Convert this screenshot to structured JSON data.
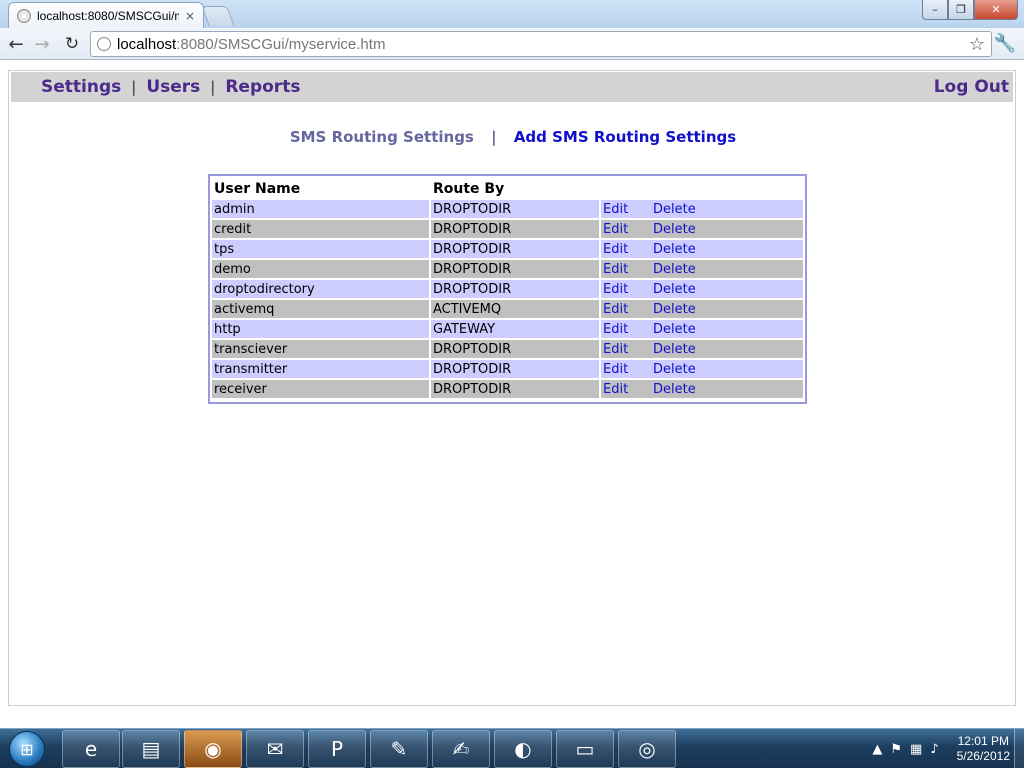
{
  "browser": {
    "tab_title": "localhost:8080/SMSCGui/m",
    "tab_close": "×",
    "url_host": "localhost",
    "url_rest": ":8080/SMSCGui/myservice.htm",
    "back_glyph": "←",
    "forward_glyph": "→",
    "reload_glyph": "↻",
    "star_glyph": "☆",
    "wrench_glyph": "🔧",
    "min_glyph": "–",
    "max_glyph": "❐",
    "close_glyph": "✕"
  },
  "topnav": {
    "settings": "Settings",
    "users": "Users",
    "reports": "Reports",
    "separator": "|",
    "logout": "Log Out"
  },
  "subnav": {
    "current": "SMS Routing Settings",
    "separator": "|",
    "add": "Add SMS Routing Settings"
  },
  "table": {
    "headers": {
      "user_name": "User Name",
      "route_by": "Route By"
    },
    "edit_label": "Edit",
    "delete_label": "Delete",
    "rows": [
      {
        "user": "admin",
        "route": "DROPTODIR"
      },
      {
        "user": "credit",
        "route": "DROPTODIR"
      },
      {
        "user": "tps",
        "route": "DROPTODIR"
      },
      {
        "user": "demo",
        "route": "DROPTODIR"
      },
      {
        "user": "droptodirectory",
        "route": "DROPTODIR"
      },
      {
        "user": "activemq",
        "route": "ACTIVEMQ"
      },
      {
        "user": "http",
        "route": "GATEWAY"
      },
      {
        "user": "transciever",
        "route": "DROPTODIR"
      },
      {
        "user": "transmitter",
        "route": "DROPTODIR"
      },
      {
        "user": "receiver",
        "route": "DROPTODIR"
      }
    ]
  },
  "colors": {
    "nav_purple": "#4a2a8a",
    "link_blue": "#1010cc",
    "row_odd": "#ccccff",
    "row_even": "#c0c0c0",
    "nav_bar": "#d3d3d3"
  },
  "taskbar": {
    "apps": [
      "internet-explorer-icon",
      "explorer-icon",
      "firefox-icon",
      "gtalk-icon",
      "powerpoint-icon",
      "paint-icon",
      "notepad-plus-icon",
      "eclipse-icon",
      "cmd-icon",
      "chrome-icon"
    ],
    "clock_time": "12:01 PM",
    "clock_date": "5/26/2012"
  }
}
